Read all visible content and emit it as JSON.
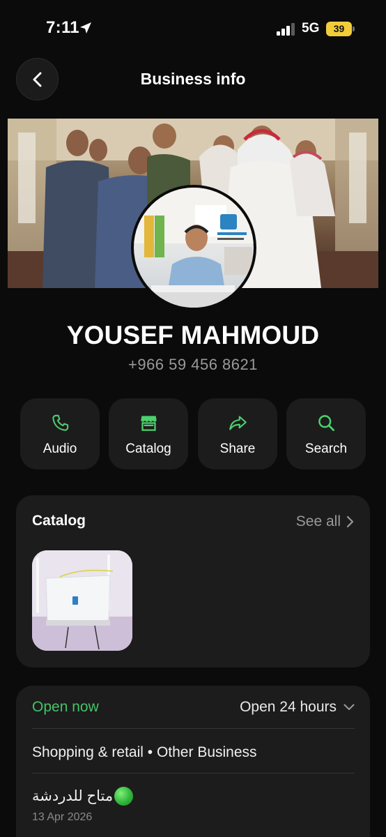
{
  "status_bar": {
    "time": "7:11",
    "network": "5G",
    "battery": "39"
  },
  "header": {
    "title": "Business info"
  },
  "profile": {
    "name": "YOUSEF MAHMOUD",
    "phone": "+966 59 456 8621"
  },
  "actions": [
    {
      "label": "Audio",
      "icon": "phone-icon"
    },
    {
      "label": "Catalog",
      "icon": "storefront-icon"
    },
    {
      "label": "Share",
      "icon": "share-arrow-icon"
    },
    {
      "label": "Search",
      "icon": "search-icon"
    }
  ],
  "catalog": {
    "title": "Catalog",
    "see_all": "See all"
  },
  "hours": {
    "status": "Open now",
    "schedule": "Open 24 hours"
  },
  "business": {
    "category": "Shopping & retail • Other Business"
  },
  "about": {
    "text": "متاح للدردشة",
    "date": "13 Apr 2026"
  },
  "colors": {
    "accent_green": "#45c36a",
    "background": "#0b0b0b",
    "card": "#1c1c1c",
    "battery": "#f2cd3a"
  }
}
